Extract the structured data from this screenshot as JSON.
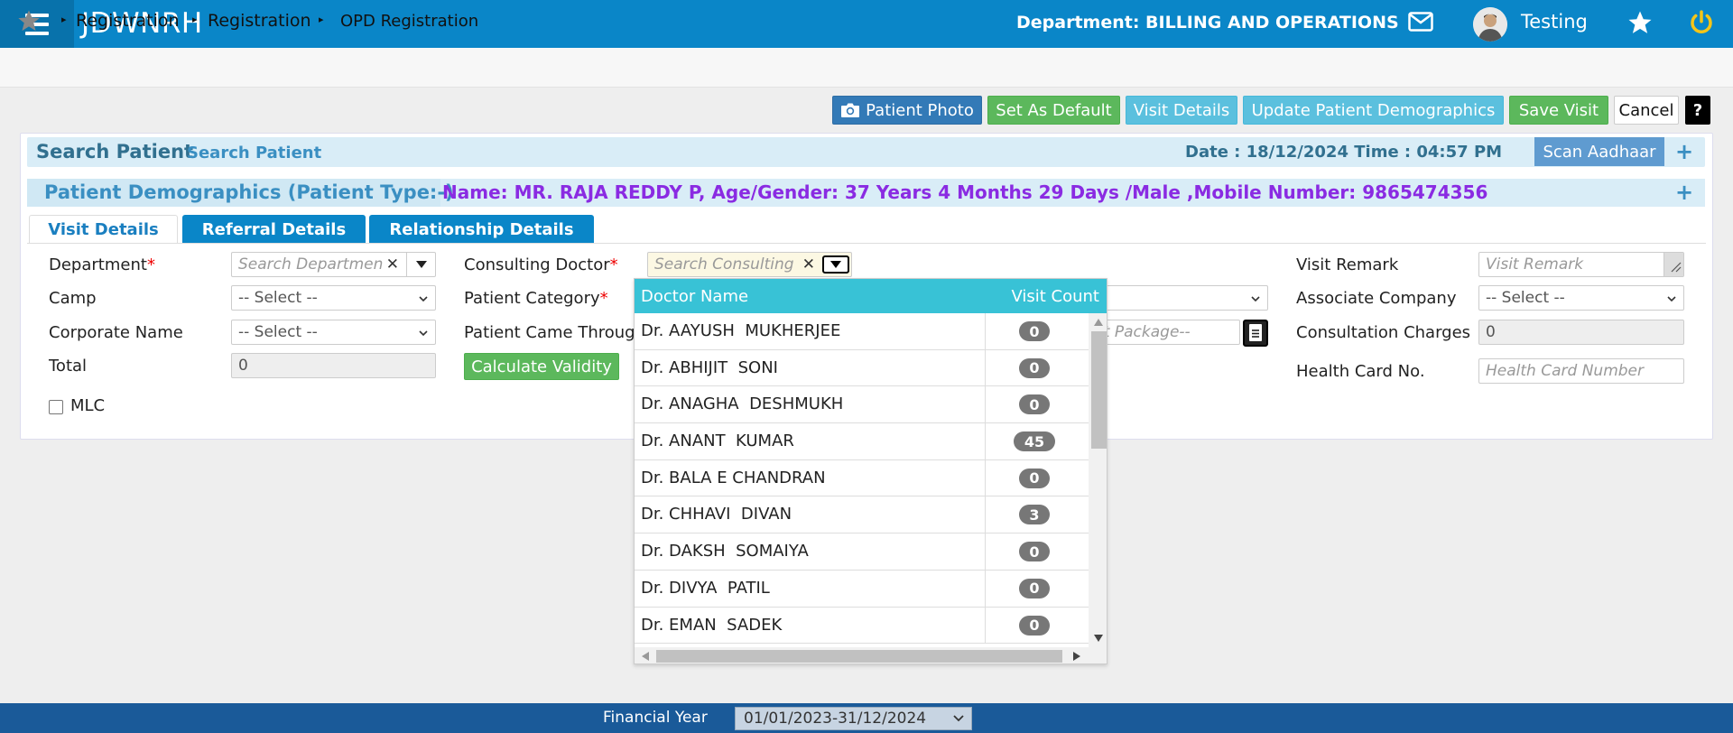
{
  "header": {
    "app_title": "JDWNRH",
    "department": "Department: BILLING AND OPERATIONS",
    "username": "Testing"
  },
  "breadcrumb": [
    "Registration",
    "Registration",
    "OPD Registration"
  ],
  "actions": {
    "patient_photo": "Patient Photo",
    "set_default": "Set As Default",
    "visit_details": "Visit Details",
    "update_demographics": "Update Patient Demographics",
    "save_visit": "Save Visit",
    "cancel": "Cancel",
    "help": "?"
  },
  "search_panel": {
    "title": "Search Patient",
    "subtitle": "Search Patient",
    "datetime": "Date : 18/12/2024 Time : 04:57 PM",
    "scan_aadhaar": "Scan Aadhaar"
  },
  "demographics": {
    "title": "Patient Demographics (Patient Type:-)",
    "info": "Name: MR. RAJA REDDY P, Age/Gender: 37 Years 4 Months 29 Days /Male ,Mobile Number: 9865474356"
  },
  "tabs": [
    "Visit Details",
    "Referral Details",
    "Relationship Details"
  ],
  "form": {
    "department_label": "Department",
    "department_placeholder": "Search Departmen",
    "camp_label": "Camp",
    "camp_value": "-- Select --",
    "corporate_label": "Corporate Name",
    "corporate_value": "-- Select --",
    "total_label": "Total",
    "total_value": "0",
    "mlc_label": "MLC",
    "consulting_label": "Consulting Doctor",
    "consulting_placeholder": "Search Consulting",
    "patient_category_label": "Patient Category",
    "came_through_label": "Patient Came Throug",
    "calculate_validity": "Calculate Validity",
    "package_placeholder": "ect Package--",
    "visit_remark_label": "Visit Remark",
    "visit_remark_placeholder": "Visit Remark",
    "associate_label": "Associate Company",
    "associate_value": "-- Select --",
    "consultation_charges_label": "Consultation Charges",
    "consultation_charges_value": "0",
    "health_card_label": "Health Card No.",
    "health_card_placeholder": "Health Card Number"
  },
  "doctor_popup": {
    "col_name": "Doctor Name",
    "col_count": "Visit Count",
    "rows": [
      {
        "name": "Dr. AAYUSH  MUKHERJEE",
        "count": "0"
      },
      {
        "name": "Dr. ABHIJIT  SONI",
        "count": "0"
      },
      {
        "name": "Dr. ANAGHA  DESHMUKH",
        "count": "0"
      },
      {
        "name": "Dr. ANANT  KUMAR",
        "count": "45"
      },
      {
        "name": "Dr. BALA E CHANDRAN",
        "count": "0"
      },
      {
        "name": "Dr. CHHAVI  DIVAN",
        "count": "3"
      },
      {
        "name": "Dr. DAKSH  SOMAIYA",
        "count": "0"
      },
      {
        "name": "Dr. DIVYA  PATIL",
        "count": "0"
      },
      {
        "name": "Dr. EMAN  SADEK",
        "count": "0"
      }
    ]
  },
  "footer": {
    "fy_label": "Financial Year",
    "fy_value": "01/01/2023-31/12/2024"
  },
  "colors": {
    "header_bg": "#0a86c8",
    "footer_bg": "#1a5a99",
    "popup_head": "#38c2d6",
    "demographics_text": "#8a2be2"
  }
}
